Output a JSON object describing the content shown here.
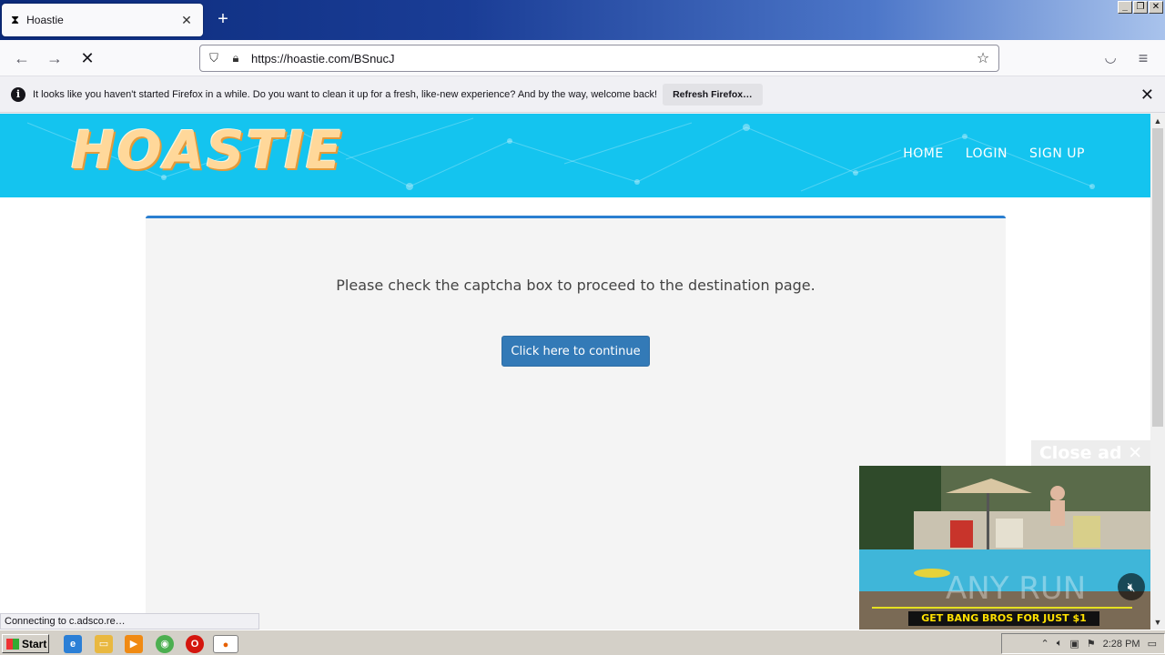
{
  "browser": {
    "tab": {
      "title": "Hoastie",
      "close": "✕"
    },
    "new_tab": "+",
    "window_controls": {
      "minimize": "_",
      "restore": "❐",
      "close": "✕"
    },
    "nav": {
      "back": "←",
      "forward": "→",
      "stop": "✕"
    },
    "url": "https://hoastie.com/BSnucJ",
    "notification": {
      "message": "It looks like you haven't started Firefox in a while. Do you want to clean it up for a fresh, like-new experience? And by the way, welcome back!",
      "button": "Refresh Firefox…",
      "close": "✕"
    },
    "status": "Connecting to c.adsco.re…"
  },
  "site": {
    "logo": "HOASTIE",
    "menu": [
      "HOME",
      "LOGIN",
      "SIGN UP"
    ],
    "prompt": "Please check the captcha box to proceed to the destination page.",
    "continue_button": "Click here to continue"
  },
  "ad": {
    "close_label": "Close ad ✕",
    "banner": "GET BANG BROS FOR JUST $1",
    "watermark": "ANY RUN"
  },
  "taskbar": {
    "start": "Start",
    "clock": "2:28 PM"
  },
  "colors": {
    "hero": "#14c4ef",
    "logo": "#ffd89a",
    "button": "#337ab7",
    "panel_accent": "#2a7fd0"
  }
}
